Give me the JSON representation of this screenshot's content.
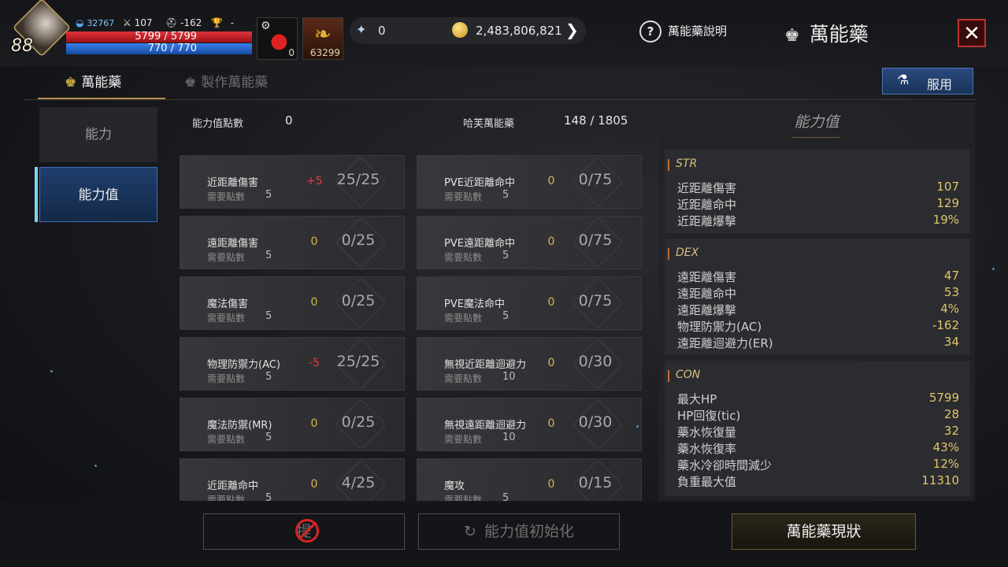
{
  "hud": {
    "level": "88",
    "exp_value": "32767",
    "stat_attack": "107",
    "stat_defense": "-162",
    "trophy": "-",
    "hp": "5799 / 5799",
    "mp": "770 / 770",
    "item1_count": "0",
    "item2_count": "63299",
    "diamond": "0",
    "gold": "2,483,806,821",
    "help_label": "萬能藥說明",
    "title": "萬能藥"
  },
  "tabs": [
    {
      "label": "萬能藥"
    },
    {
      "label": "製作萬能藥"
    }
  ],
  "use_button": "服用",
  "sidebar": [
    {
      "label": "能力"
    },
    {
      "label": "能力值"
    }
  ],
  "summary": {
    "points_label": "能力值點數",
    "points_value": "0",
    "elixir_label": "哈芙萬能藥",
    "elixir_value": "148 / 1805"
  },
  "cards_left": [
    {
      "name": "近距離傷害",
      "req_label": "需要點數",
      "req": "5",
      "delta": "+5",
      "progress": "25/25"
    },
    {
      "name": "遠距離傷害",
      "req_label": "需要點數",
      "req": "5",
      "delta": "0",
      "progress": "0/25"
    },
    {
      "name": "魔法傷害",
      "req_label": "需要點數",
      "req": "5",
      "delta": "0",
      "progress": "0/25"
    },
    {
      "name": "物理防禦力(AC)",
      "req_label": "需要點數",
      "req": "5",
      "delta": "-5",
      "progress": "25/25"
    },
    {
      "name": "魔法防禦(MR)",
      "req_label": "需要點數",
      "req": "5",
      "delta": "0",
      "progress": "0/25"
    },
    {
      "name": "近距離命中",
      "req_label": "需要點數",
      "req": "5",
      "delta": "0",
      "progress": "4/25"
    }
  ],
  "cards_right": [
    {
      "name": "PVE近距離命中",
      "req_label": "需要點數",
      "req": "5",
      "delta": "0",
      "progress": "0/75"
    },
    {
      "name": "PVE遠距離命中",
      "req_label": "需要點數",
      "req": "5",
      "delta": "0",
      "progress": "0/75"
    },
    {
      "name": "PVE魔法命中",
      "req_label": "需要點數",
      "req": "5",
      "delta": "0",
      "progress": "0/75"
    },
    {
      "name": "無視近距離迴避力",
      "req_label": "需要點數",
      "req": "10",
      "delta": "0",
      "progress": "0/30"
    },
    {
      "name": "無視遠距離迴避力",
      "req_label": "需要點數",
      "req": "10",
      "delta": "0",
      "progress": "0/30"
    },
    {
      "name": "魔攻",
      "req_label": "需要點數",
      "req": "5",
      "delta": "0",
      "progress": "0/15"
    }
  ],
  "stats_panel": {
    "title": "能力值",
    "groups": [
      {
        "name": "STR",
        "rows": [
          {
            "label": "近距離傷害",
            "value": "107"
          },
          {
            "label": "近距離命中",
            "value": "129"
          },
          {
            "label": "近距離爆擊",
            "value": "19%"
          }
        ]
      },
      {
        "name": "DEX",
        "rows": [
          {
            "label": "遠距離傷害",
            "value": "47"
          },
          {
            "label": "遠距離命中",
            "value": "53"
          },
          {
            "label": "遠距離爆擊",
            "value": "4%"
          },
          {
            "label": "物理防禦力(AC)",
            "value": "-162"
          },
          {
            "label": "遠距離迴避力(ER)",
            "value": "34"
          }
        ]
      },
      {
        "name": "CON",
        "rows": [
          {
            "label": "最大HP",
            "value": "5799"
          },
          {
            "label": "HP回復(tic)",
            "value": "28"
          },
          {
            "label": "藥水恢復量",
            "value": "32"
          },
          {
            "label": "藥水恢復率",
            "value": "43%"
          },
          {
            "label": "藥水冷卻時間減少",
            "value": "12%"
          },
          {
            "label": "負重最大值",
            "value": "11310"
          }
        ]
      }
    ]
  },
  "bottom": {
    "btn1": "提",
    "btn2": "能力值初始化",
    "btn3": "萬能藥現狀"
  },
  "colors": {
    "positive": "#e23b3b",
    "neutral": "#d8b64b",
    "accent_blue": "#3e6fb6",
    "stat_value": "#e3c566"
  }
}
